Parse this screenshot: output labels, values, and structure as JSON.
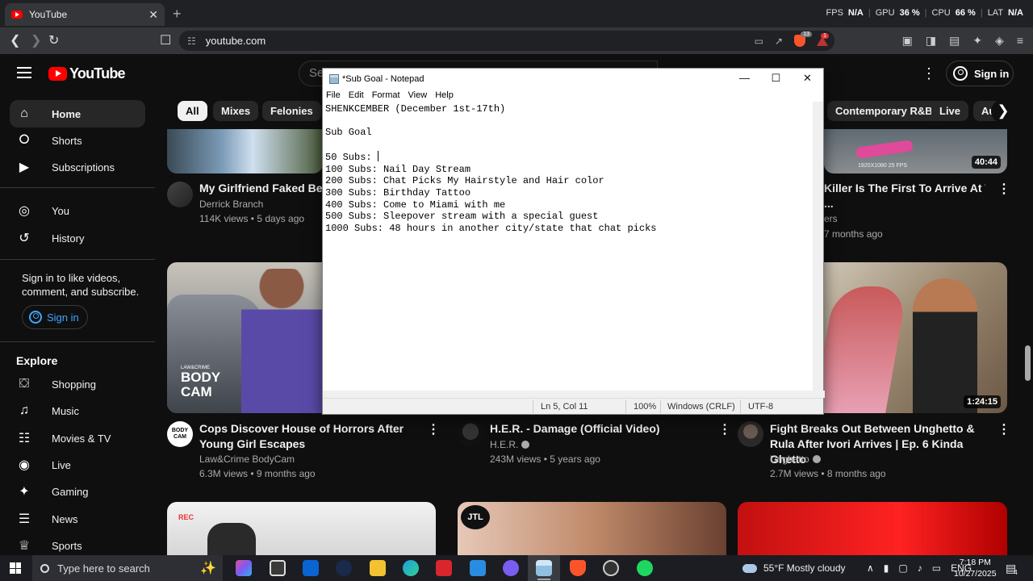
{
  "browser": {
    "tab_title": "YouTube",
    "tab_close": "✕",
    "new_tab": "+",
    "url": "youtube.com",
    "brave_badge": "13",
    "rewards_badge": "1",
    "perf": {
      "fps_label": "FPS",
      "fps_value": "N/A",
      "gpu_label": "GPU",
      "gpu_value": "36 %",
      "cpu_label": "CPU",
      "cpu_value": "66 %",
      "lat_label": "LAT",
      "lat_value": "N/A"
    }
  },
  "youtube": {
    "logo_text": "YouTube",
    "search_placeholder": "Se",
    "signin_label": "Sign in",
    "sidebar": {
      "items": [
        {
          "label": "Home",
          "icon": "home-icon"
        },
        {
          "label": "Shorts",
          "icon": "shorts-icon"
        },
        {
          "label": "Subscriptions",
          "icon": "subscriptions-icon"
        },
        {
          "label": "You",
          "icon": "you-icon"
        },
        {
          "label": "History",
          "icon": "history-icon"
        }
      ],
      "signin_prompt": "Sign in to like videos, comment, and subscribe.",
      "signin_button": "Sign in",
      "explore_heading": "Explore",
      "explore_items": [
        {
          "label": "Shopping",
          "icon": "shopping-icon"
        },
        {
          "label": "Music",
          "icon": "music-icon"
        },
        {
          "label": "Movies & TV",
          "icon": "movies-icon"
        },
        {
          "label": "Live",
          "icon": "live-icon"
        },
        {
          "label": "Gaming",
          "icon": "gaming-icon"
        },
        {
          "label": "News",
          "icon": "news-icon"
        },
        {
          "label": "Sports",
          "icon": "sports-icon"
        }
      ]
    },
    "chips": [
      "All",
      "Mixes",
      "Felonies",
      "Contemporary R&B",
      "Live",
      "Au"
    ],
    "videos": [
      {
        "title": "My Girlfriend Faked Being",
        "channel": "Derrick Branch",
        "meta": "114K views • 5 days ago"
      },
      {
        "title": "Killer Is The First To Arrive At The",
        "title2": "...",
        "channel": "ers",
        "meta": "7 months ago",
        "duration": "40:44",
        "overlay": "1920X1080 25 FPS"
      },
      {
        "title": "Cops Discover House of Horrors After Young Girl Escapes",
        "channel": "Law&Crime BodyCam",
        "meta": "6.3M views • 9 months ago",
        "overlay_top": "LAW&CRIME",
        "overlay_big1": "BODY",
        "overlay_big2": "CAM",
        "avatar_text1": "BODY",
        "avatar_text2": "CAM"
      },
      {
        "title": "H.E.R. - Damage (Official Video)",
        "channel": "H.E.R.",
        "meta": "243M views • 5 years ago"
      },
      {
        "title": "Fight Breaks Out Between Unghetto & Rula After Ivori Arrives | Ep. 6 Kinda Ghetto",
        "channel": "Unghetto",
        "meta": "2.7M views • 8 months ago",
        "duration": "1:24:15"
      }
    ],
    "bottom_row": {
      "rec_label": "REC",
      "channel_logo": "JTL"
    }
  },
  "notepad": {
    "title": "*Sub Goal - Notepad",
    "menu": [
      "File",
      "Edit",
      "Format",
      "View",
      "Help"
    ],
    "lines": [
      "SHENKCEMBER (December 1st-17th)",
      "",
      "Sub Goal",
      "",
      "50 Subs: ",
      "100 Subs: Nail Day Stream",
      "200 Subs: Chat Picks My Hairstyle and Hair color",
      "300 Subs: Birthday Tattoo",
      "400 Subs: Come to Miami with me",
      "500 Subs: Sleepover stream with a special guest",
      "1000 Subs: 48 hours in another city/state that chat picks"
    ],
    "status": {
      "position": "Ln 5, Col 11",
      "zoom": "100%",
      "line_ending": "Windows (CRLF)",
      "encoding": "UTF-8"
    }
  },
  "taskbar": {
    "search_placeholder": "Type here to search",
    "weather": "55°F  Mostly cloudy",
    "language": "ENG",
    "time": "7:18 PM",
    "date": "10/27/2025",
    "notification_count": "4"
  }
}
